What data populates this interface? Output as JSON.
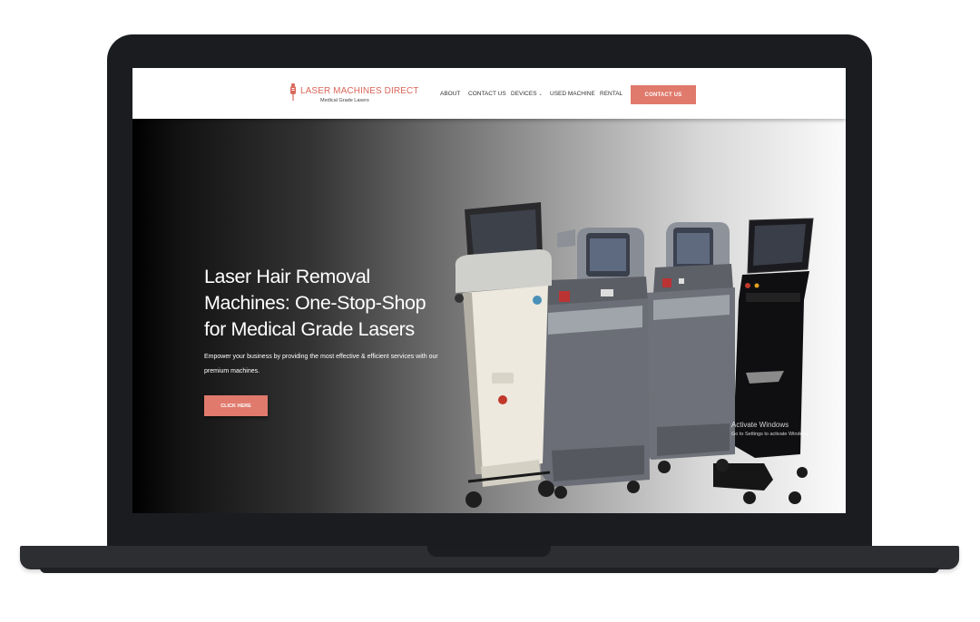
{
  "logo": {
    "title": "LASER MACHINES DIRECT",
    "subtitle": "Medical Grade Lasers"
  },
  "nav": {
    "items": [
      {
        "label": "ABOUT"
      },
      {
        "label": "CONTACT US"
      },
      {
        "label": "DEVICES",
        "has_dropdown": true
      },
      {
        "label": "USED MACHINE"
      },
      {
        "label": "RENTAL"
      }
    ],
    "cta_label": "CONTACT US"
  },
  "hero": {
    "title": "Laser Hair Removal Machines: One-Stop-Shop for Medical Grade Lasers",
    "subtitle": "Empower your business by providing the most effective & efficient services with our premium machines.",
    "button_label": "CLICK HERE"
  },
  "watermark": {
    "title": "Activate Windows",
    "subtitle": "Go to Settings to activate Windows."
  },
  "colors": {
    "accent": "#e07a6c",
    "logo": "#d9675a"
  }
}
